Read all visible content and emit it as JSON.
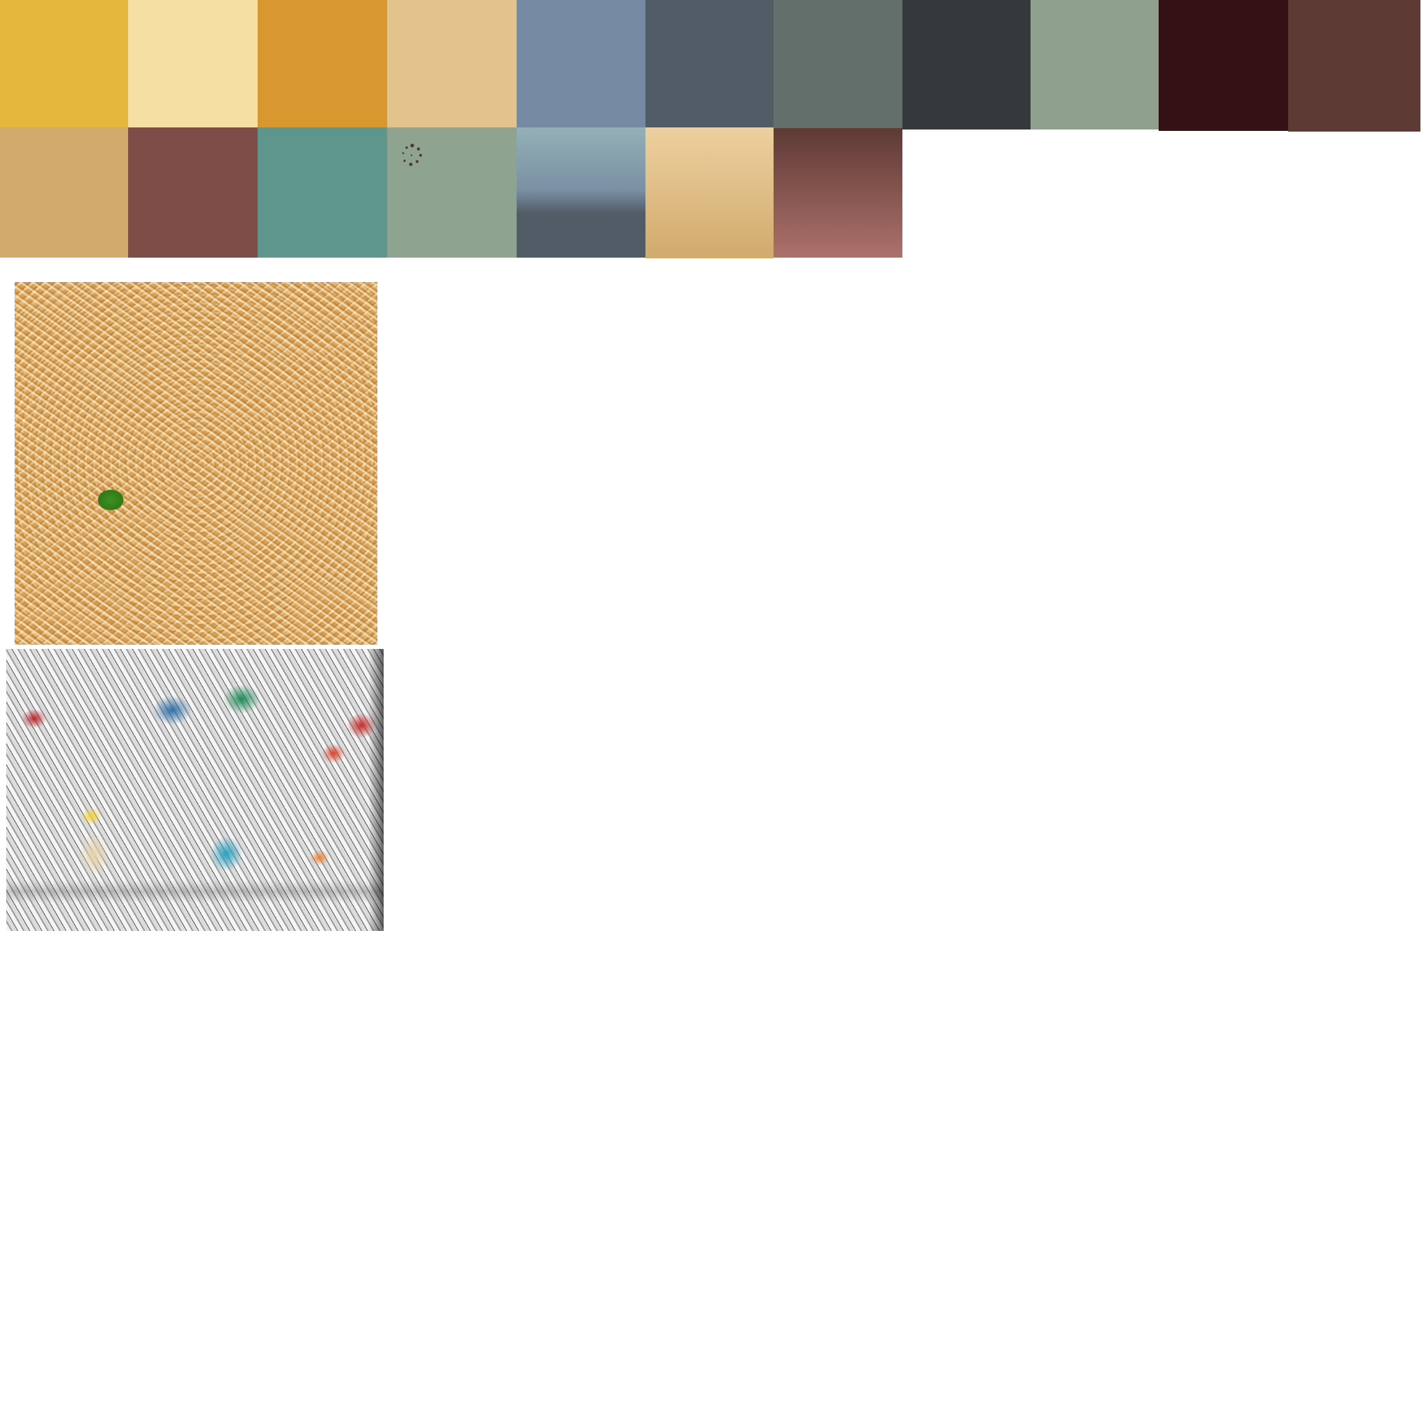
{
  "palette": {
    "swatches": [
      {
        "name": "mustard-yellow",
        "color": "#e5b83d"
      },
      {
        "name": "pale-cream",
        "color": "#f5dfa2"
      },
      {
        "name": "orange-ochre",
        "color": "#d9972f"
      },
      {
        "name": "sand-beige",
        "color": "#e4c28b"
      },
      {
        "name": "slate-blue",
        "color": "#768ba3"
      },
      {
        "name": "dark-slate",
        "color": "#525c67"
      },
      {
        "name": "gray-green",
        "color": "#636f6b"
      },
      {
        "name": "charcoal",
        "color": "#35393c"
      },
      {
        "name": "sage-green",
        "color": "#8fa08f"
      },
      {
        "name": "dark-maroon",
        "color": "#331114"
      },
      {
        "name": "brown-red",
        "color": "#5e3a35"
      },
      {
        "name": "tan",
        "color": "#d1aa6c"
      },
      {
        "name": "rosewood",
        "color": "#7f4d47"
      },
      {
        "name": "teal",
        "color": "#5e968e"
      },
      {
        "name": "sage-gray",
        "color": "#8fa391"
      },
      {
        "name": "blue-gray-gradient",
        "color": "#94b0b6",
        "color_end": "#525c67"
      },
      {
        "name": "cream-tan-gradient",
        "color": "#edd09f",
        "color_end": "#d1aa6c"
      },
      {
        "name": "brown-rose-gradient",
        "color": "#5e3a35",
        "color_end": "#ad716b"
      }
    ]
  },
  "images": {
    "pasta": {
      "icon": "pasta-photo"
    },
    "paper_bale": {
      "icon": "compressed-paper-bale-photo"
    }
  },
  "loading": {
    "icon": "loading-spinner-icon",
    "color": "#4a3a33"
  }
}
